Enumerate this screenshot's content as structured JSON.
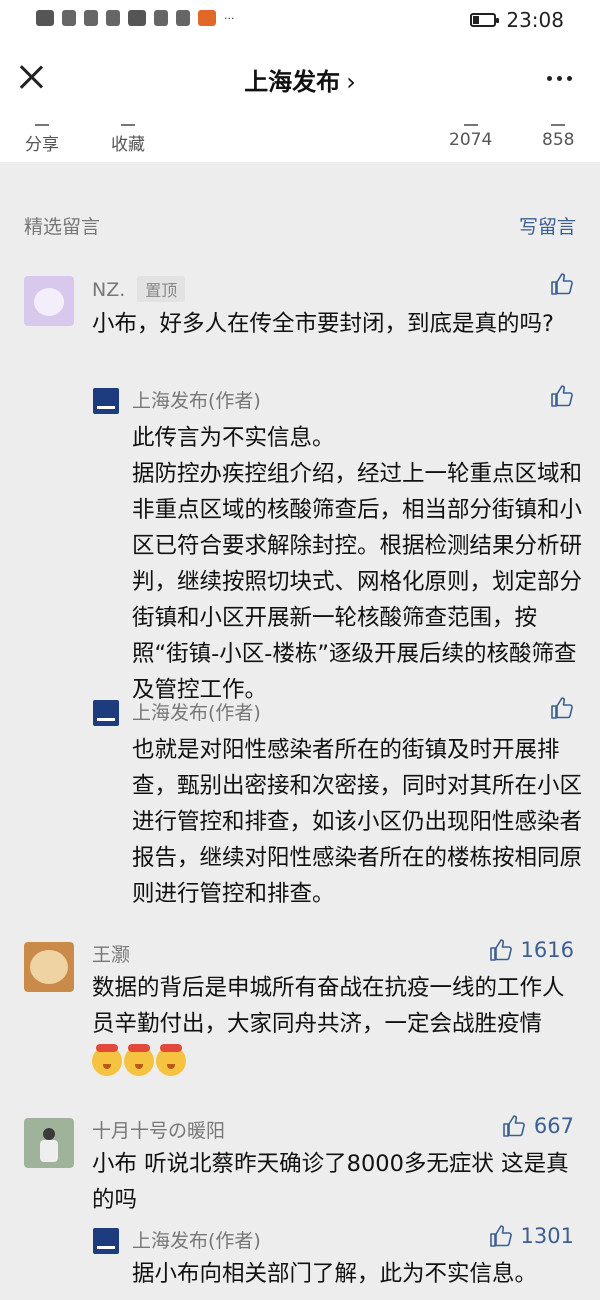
{
  "status_bar": {
    "time": "23:08",
    "icons": [
      "hd-icon",
      "4g-signal-icon",
      "hotspot-icon",
      "wechat-icon",
      "app-icon",
      "app-icon",
      "app-icon",
      "app-icon"
    ],
    "more": "···"
  },
  "nav": {
    "title": "上海发布",
    "chevron": "›"
  },
  "actions": {
    "share": "分享",
    "collect": "收藏",
    "count_left": "2074",
    "count_right": "858"
  },
  "section": {
    "title": "精选留言",
    "write": "写留言"
  },
  "comments": [
    {
      "name": "NZ.",
      "pinned": "置顶",
      "likes": "",
      "text": "小布，好多人在传全市要封闭，到底是真的吗?",
      "replies": [
        {
          "name": "上海发布(作者)",
          "likes": "",
          "lines": [
            "此传言为不实信息。",
            "据防控办疾控组介绍，经过上一轮重点区域和非重点区域的核酸筛查后，相当部分街镇和小区已符合要求解除封控。根据检测结果分析研判，继续按照切块式、网格化原则，划定部分街镇和小区开展新一轮核酸筛查范围，按照“街镇-小区-楼栋”逐级开展后续的核酸筛查及管控工作。"
          ]
        },
        {
          "name": "上海发布(作者)",
          "likes": "",
          "lines": [
            "也就是对阳性感染者所在的街镇及时开展排查，甄别出密接和次密接，同时对其所在小区进行管控和排查，如该小区仍出现阳性感染者报告，继续对阳性感染者所在的楼栋按相同原则进行管控和排查。"
          ]
        }
      ]
    },
    {
      "name": "王灏",
      "likes": "1616",
      "text": "数据的背后是申城所有奋战在抗疫一线的工作人员辛勤付出，大家同舟共济，一定会战胜疫情"
    },
    {
      "name": "十月十号の暖阳",
      "likes": "667",
      "text": "小布 听说北蔡昨天确诊了8000多无症状 这是真的吗",
      "replies": [
        {
          "name": "上海发布(作者)",
          "likes": "1301",
          "lines": [
            "据小布向相关部门了解，此为不实信息。"
          ]
        }
      ]
    }
  ]
}
